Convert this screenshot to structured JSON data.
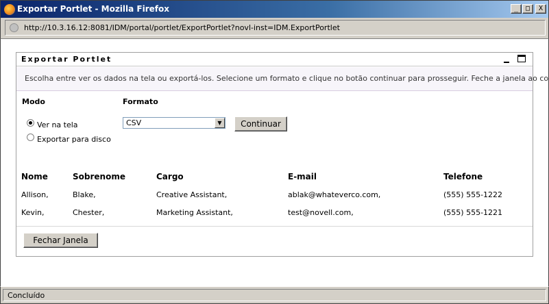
{
  "window": {
    "title": "Exportar Portlet - Mozilla Firefox",
    "min_glyph": "_",
    "max_glyph": "□",
    "close_glyph": "X"
  },
  "address": {
    "url": "http://10.3.16.12:8081/IDM/portal/portlet/ExportPortlet?novl-inst=IDM.ExportPortlet"
  },
  "portlet": {
    "title": "Exportar Portlet",
    "description": "Escolha entre ver os dados na tela ou exportá-los. Selecione um formato e clique no botão continuar para prosseguir. Feche a janela ao concluir."
  },
  "form": {
    "mode_label": "Modo",
    "format_label": "Formato",
    "options": [
      "Ver na tela",
      "Exportar para disco"
    ],
    "selected_option": "Ver na tela",
    "format_value": "CSV",
    "continue_label": "Continuar"
  },
  "table": {
    "headers": [
      "Nome",
      "Sobrenome",
      "Cargo",
      "E-mail",
      "Telefone"
    ],
    "rows": [
      [
        "Allison,",
        "Blake,",
        "Creative Assistant,",
        "ablak@whateverco.com,",
        "(555) 555-1222"
      ],
      [
        "Kevin,",
        "Chester,",
        "Marketing Assistant,",
        "test@novell.com,",
        "(555) 555-1221"
      ]
    ]
  },
  "close_button_label": "Fechar Janela",
  "status": {
    "text": "Concluído"
  }
}
